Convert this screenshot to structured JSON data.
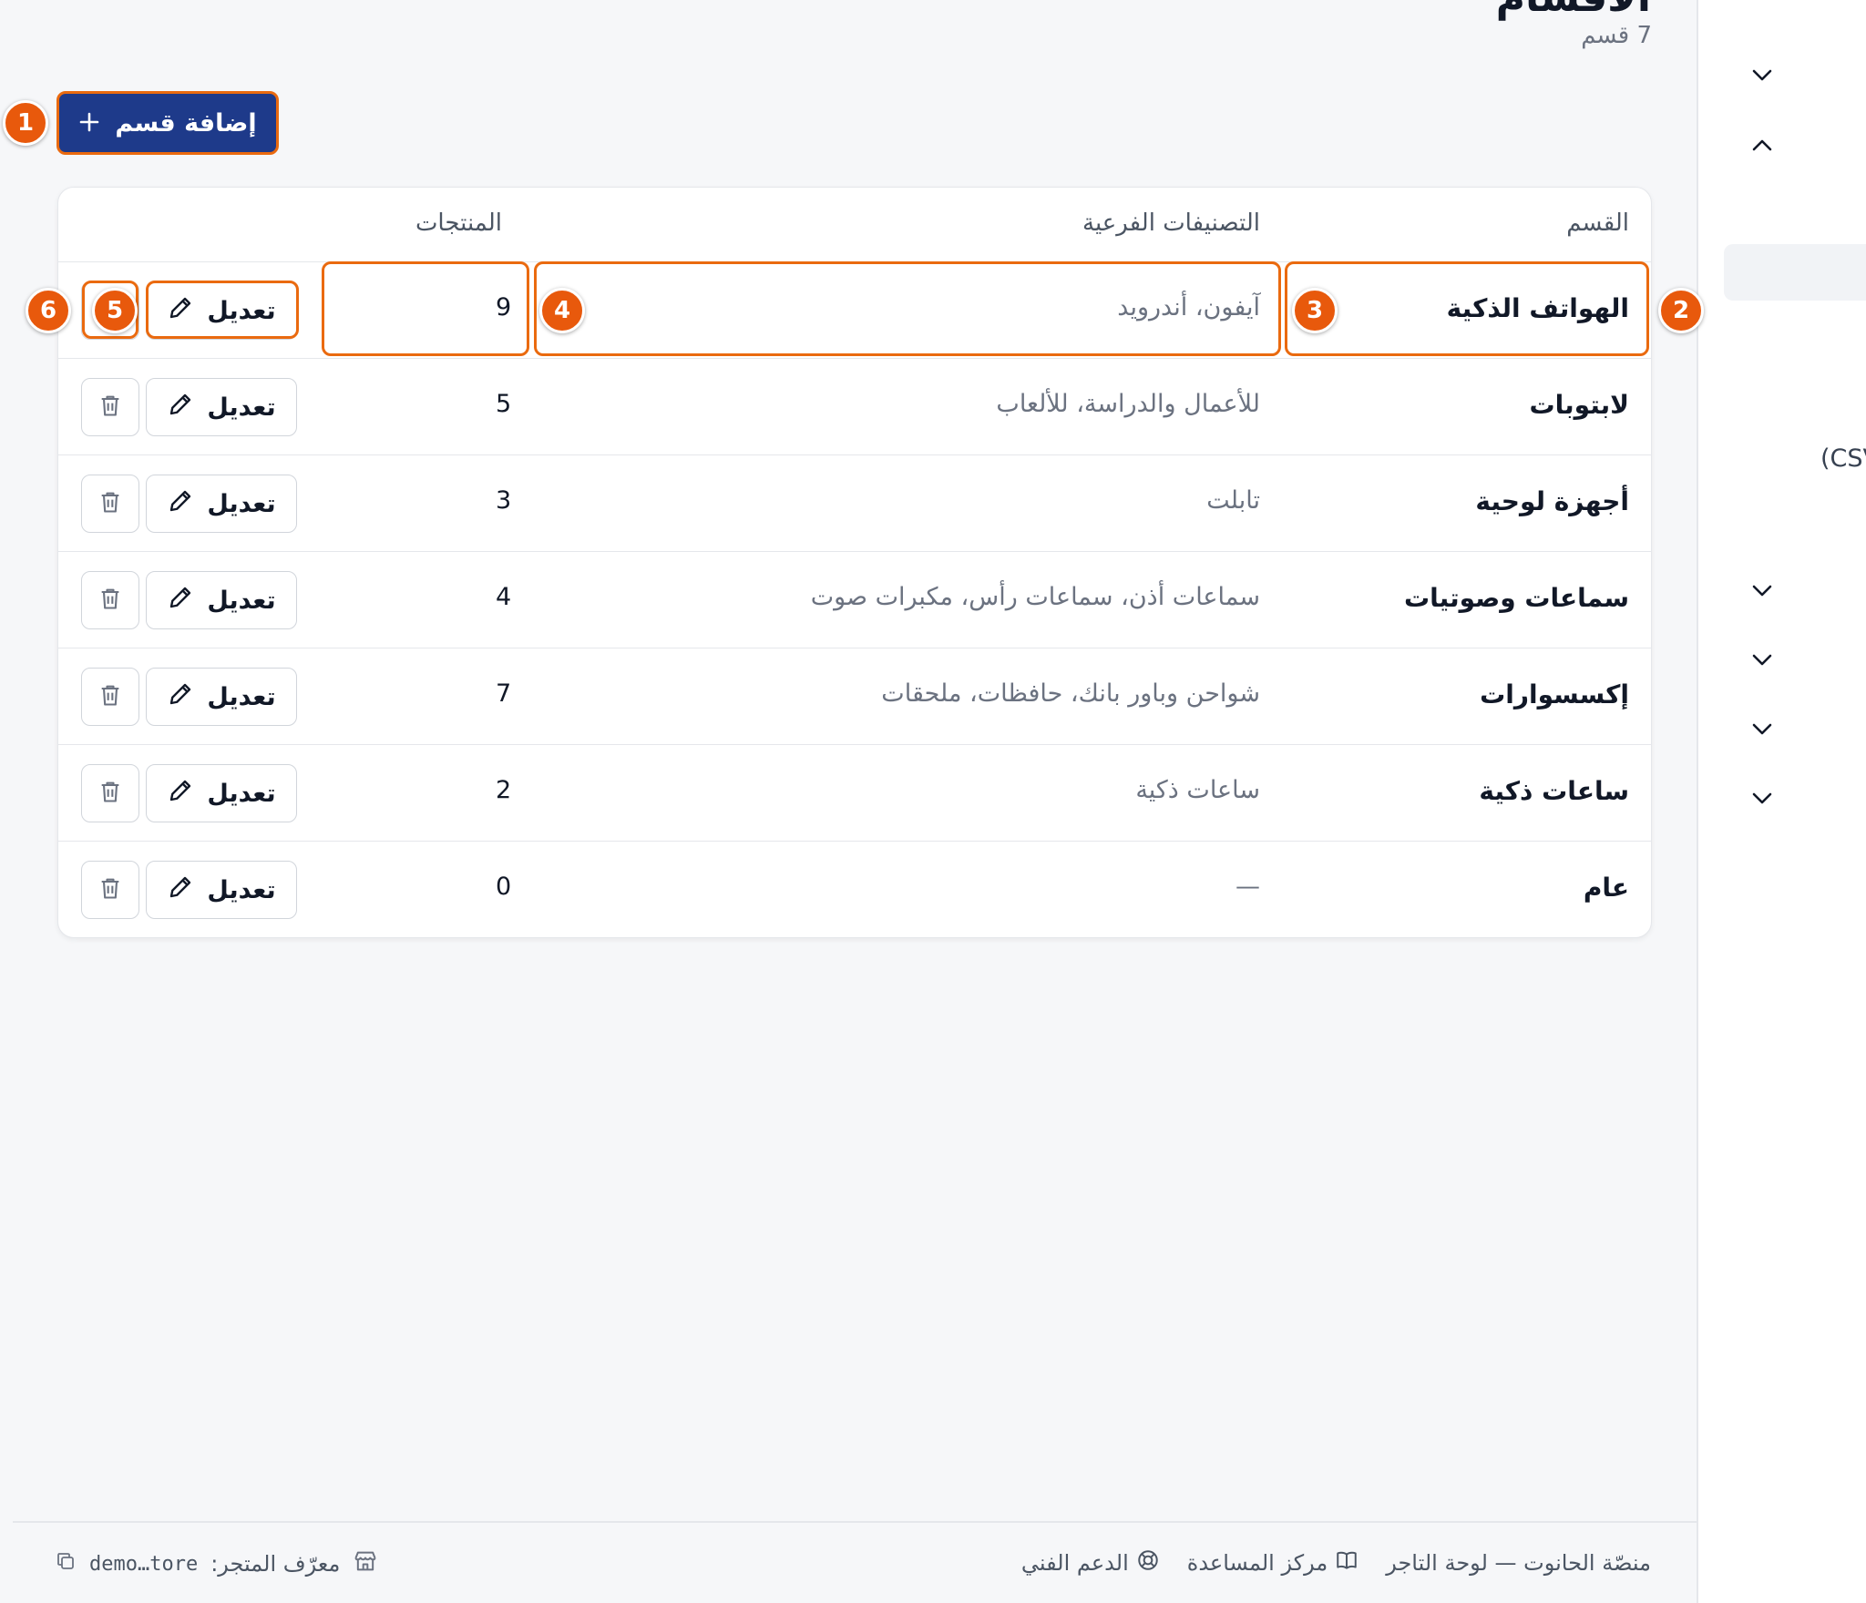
{
  "page": {
    "title": "الأقسام",
    "subtitle": "7 قسم",
    "add_button_label": "إضافة قسم"
  },
  "table": {
    "headers": {
      "category": "القسم",
      "subcategories": "التصنيفات الفرعية",
      "products": "المنتجات"
    },
    "edit_label": "تعديل",
    "rows": [
      {
        "name": "الهواتف الذكية",
        "subcategories": "آيفون، أندرويد",
        "products": "9"
      },
      {
        "name": "لابتوبات",
        "subcategories": "للأعمال والدراسة، للألعاب",
        "products": "5"
      },
      {
        "name": "أجهزة لوحية",
        "subcategories": "تابلت",
        "products": "3"
      },
      {
        "name": "سماعات وصوتيات",
        "subcategories": "سماعات أذن، سماعات رأس، مكبرات صوت",
        "products": "4"
      },
      {
        "name": "إكسسوارات",
        "subcategories": "شواحن وباور بانك، حافظات، ملحقات",
        "products": "7"
      },
      {
        "name": "ساعات ذكية",
        "subcategories": "ساعات ذكية",
        "products": "2"
      },
      {
        "name": "عام",
        "subcategories": "—",
        "products": "0"
      }
    ]
  },
  "sidebar": {
    "partial_text": "(CSV"
  },
  "footer": {
    "platform": "منصّة الحانوت — لوحة التاجر",
    "help_center": "مركز المساعدة",
    "support": "الدعم الفني",
    "store_id_label": "معرّف المتجر:",
    "store_id_value": "demo…tore"
  },
  "annotations": [
    "1",
    "2",
    "3",
    "4",
    "5",
    "6"
  ],
  "colors": {
    "primary": "#1e3a8a",
    "annotation": "#e8590c",
    "background": "#f6f7f9"
  },
  "icons": {
    "add": "plus-icon",
    "edit": "pencil-icon",
    "delete": "trash-icon",
    "sidebar": "chevron-icon",
    "help": "book-icon",
    "support": "lifebuoy-icon",
    "store": "store-icon",
    "copy": "copy-icon"
  }
}
